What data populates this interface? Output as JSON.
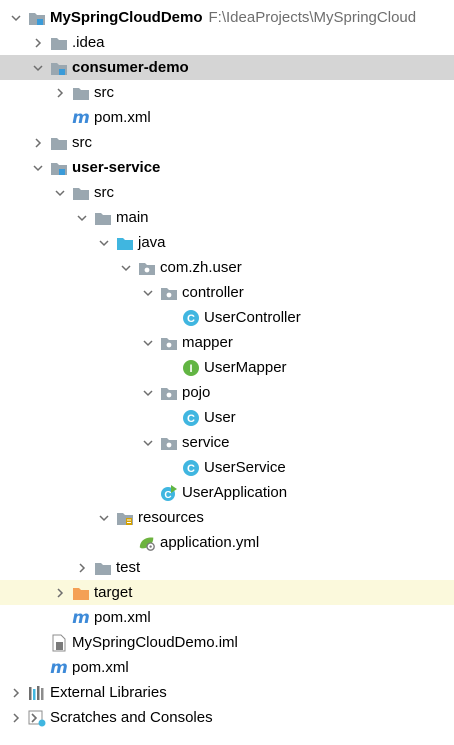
{
  "project": {
    "name": "MySpringCloudDemo",
    "path": "F:\\IdeaProjects\\MySpringCloud"
  },
  "tree": [
    {
      "label": "MySpringCloudDemo",
      "secondary": "F:\\IdeaProjects\\MySpringCloud",
      "depth": 0,
      "chevron": "down",
      "icon": "module-folder-icon",
      "bold": true
    },
    {
      "label": ".idea",
      "depth": 1,
      "chevron": "right",
      "icon": "folder-icon"
    },
    {
      "label": "consumer-demo",
      "depth": 1,
      "chevron": "down",
      "icon": "module-folder-icon",
      "bold": true,
      "state": "selected"
    },
    {
      "label": "src",
      "depth": 2,
      "chevron": "right",
      "icon": "folder-icon"
    },
    {
      "label": "pom.xml",
      "depth": 2,
      "chevron": "none",
      "icon": "maven-file-icon"
    },
    {
      "label": "src",
      "depth": 1,
      "chevron": "right",
      "icon": "folder-icon"
    },
    {
      "label": "user-service",
      "depth": 1,
      "chevron": "down",
      "icon": "module-folder-icon",
      "bold": true
    },
    {
      "label": "src",
      "depth": 2,
      "chevron": "down",
      "icon": "folder-icon"
    },
    {
      "label": "main",
      "depth": 3,
      "chevron": "down",
      "icon": "folder-icon"
    },
    {
      "label": "java",
      "depth": 4,
      "chevron": "down",
      "icon": "source-folder-icon"
    },
    {
      "label": "com.zh.user",
      "depth": 5,
      "chevron": "down",
      "icon": "package-icon"
    },
    {
      "label": "controller",
      "depth": 6,
      "chevron": "down",
      "icon": "package-icon"
    },
    {
      "label": "UserController",
      "depth": 7,
      "chevron": "none",
      "icon": "class-icon"
    },
    {
      "label": "mapper",
      "depth": 6,
      "chevron": "down",
      "icon": "package-icon"
    },
    {
      "label": "UserMapper",
      "depth": 7,
      "chevron": "none",
      "icon": "interface-icon"
    },
    {
      "label": "pojo",
      "depth": 6,
      "chevron": "down",
      "icon": "package-icon"
    },
    {
      "label": "User",
      "depth": 7,
      "chevron": "none",
      "icon": "class-icon"
    },
    {
      "label": "service",
      "depth": 6,
      "chevron": "down",
      "icon": "package-icon"
    },
    {
      "label": "UserService",
      "depth": 7,
      "chevron": "none",
      "icon": "class-icon"
    },
    {
      "label": "UserApplication",
      "depth": 6,
      "chevron": "none",
      "icon": "spring-boot-class-icon"
    },
    {
      "label": "resources",
      "depth": 4,
      "chevron": "down",
      "icon": "resources-folder-icon"
    },
    {
      "label": "application.yml",
      "depth": 5,
      "chevron": "none",
      "icon": "spring-config-icon"
    },
    {
      "label": "test",
      "depth": 3,
      "chevron": "right",
      "icon": "folder-icon"
    },
    {
      "label": "target",
      "depth": 2,
      "chevron": "right",
      "icon": "excluded-folder-icon",
      "state": "excluded"
    },
    {
      "label": "pom.xml",
      "depth": 2,
      "chevron": "none",
      "icon": "maven-file-icon"
    },
    {
      "label": "MySpringCloudDemo.iml",
      "depth": 1,
      "chevron": "none",
      "icon": "iml-file-icon"
    },
    {
      "label": "pom.xml",
      "depth": 1,
      "chevron": "none",
      "icon": "maven-file-icon"
    },
    {
      "label": "External Libraries",
      "depth": 0,
      "chevron": "right",
      "icon": "libraries-icon"
    },
    {
      "label": "Scratches and Consoles",
      "depth": 0,
      "chevron": "right",
      "icon": "scratches-icon"
    }
  ],
  "colors": {
    "selected_row": "#d5d5d5",
    "excluded_row": "#fbf9dc",
    "folder": "#9aa7b0",
    "source_folder": "#40b6e0",
    "excluded_folder": "#f4a055",
    "class_circle": "#40b6e0",
    "interface_circle": "#62b543",
    "maven": "#3d8ad8"
  }
}
